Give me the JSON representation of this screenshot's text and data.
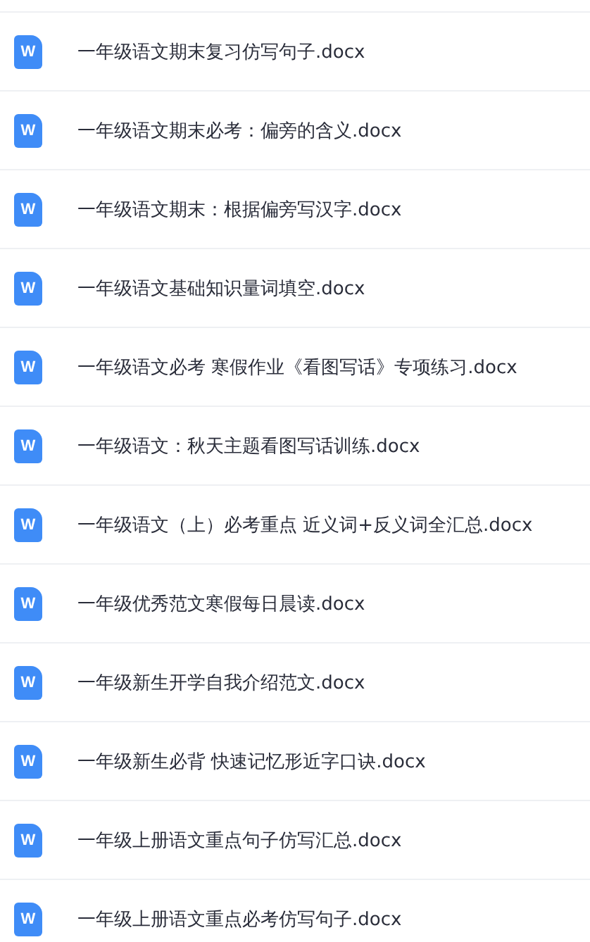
{
  "files": [
    {
      "name": "一年级语文期末复习仿写句子.docx",
      "icon_letter": "W"
    },
    {
      "name": "一年级语文期末必考：偏旁的含义.docx",
      "icon_letter": "W"
    },
    {
      "name": "一年级语文期末：根据偏旁写汉字.docx",
      "icon_letter": "W"
    },
    {
      "name": "一年级语文基础知识量词填空.docx",
      "icon_letter": "W"
    },
    {
      "name": "一年级语文必考 寒假作业《看图写话》专项练习.docx",
      "icon_letter": "W"
    },
    {
      "name": "一年级语文：秋天主题看图写话训练.docx",
      "icon_letter": "W"
    },
    {
      "name": "一年级语文（上）必考重点 近义词+反义词全汇总.docx",
      "icon_letter": "W"
    },
    {
      "name": "一年级优秀范文寒假每日晨读.docx",
      "icon_letter": "W"
    },
    {
      "name": "一年级新生开学自我介绍范文.docx",
      "icon_letter": "W"
    },
    {
      "name": "一年级新生必背 快速记忆形近字口诀.docx",
      "icon_letter": "W"
    },
    {
      "name": "一年级上册语文重点句子仿写汇总.docx",
      "icon_letter": "W"
    },
    {
      "name": "一年级上册语文重点必考仿写句子.docx",
      "icon_letter": "W"
    }
  ]
}
